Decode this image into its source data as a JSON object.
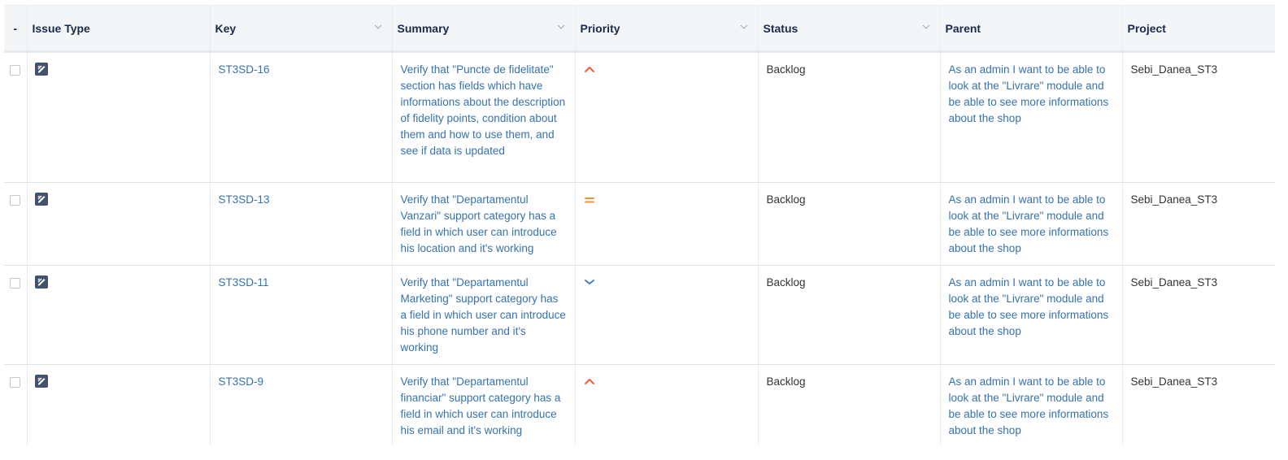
{
  "columns": {
    "select": "-",
    "issue_type": "Issue Type",
    "key": "Key",
    "summary": "Summary",
    "priority": "Priority",
    "status": "Status",
    "parent": "Parent",
    "project": "Project"
  },
  "rows": [
    {
      "issue_type_icon": "test-issue-icon",
      "key": "ST3SD-16",
      "summary": "Verify that \"Puncte de fidelitate\" section has fields which have informations about the description of fidelity points, condition about them and how to use them, and see if data is updated",
      "priority": "high-priority-icon",
      "status": "Backlog",
      "parent": "As an admin I want to be able to look at the \"Livrare\" module and be able to see more informations about the shop",
      "project": "Sebi_Danea_ST3"
    },
    {
      "issue_type_icon": "test-issue-icon",
      "key": "ST3SD-13",
      "summary": "Verify that \"Departamentul Vanzari\" support category has a field in which user can introduce his location and it's working",
      "priority": "medium-priority-icon",
      "status": "Backlog",
      "parent": "As an admin I want to be able to look at the \"Livrare\" module and be able to see more informations about the shop",
      "project": "Sebi_Danea_ST3"
    },
    {
      "issue_type_icon": "test-issue-icon",
      "key": "ST3SD-11",
      "summary": "Verify that \"Departamentul Marketing\" support category has a field in which user can introduce his phone number and it's working",
      "priority": "low-priority-icon",
      "status": "Backlog",
      "parent": "As an admin I want to be able to look at the \"Livrare\" module and be able to see more informations about the shop",
      "project": "Sebi_Danea_ST3"
    },
    {
      "issue_type_icon": "test-issue-icon",
      "key": "ST3SD-9",
      "summary": "Verify that \"Departamentul financiar\" support category has a field in which user can introduce his email and it's working",
      "priority": "high-priority-icon",
      "status": "Backlog",
      "parent": "As an admin I want to be able to look at the \"Livrare\" module and be able to see more informations about the shop",
      "project": "Sebi_Danea_ST3"
    }
  ],
  "colors": {
    "link": "#3572b0",
    "high_priority": "#f15c3c",
    "medium_priority": "#f79232",
    "low_priority": "#3b7fc4",
    "header_bg": "#f4f5f7"
  }
}
